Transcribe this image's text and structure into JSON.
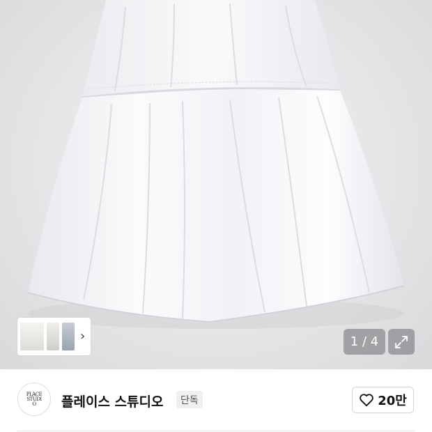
{
  "gallery": {
    "counter": "1 / 4",
    "thumbnails": [
      "thumbnail-1",
      "thumbnail-2",
      "thumbnail-3"
    ],
    "next_icon": "chevron-right-icon",
    "expand_icon": "expand-icon"
  },
  "shop": {
    "logo_text": "PLACE STUDIO",
    "name": "플레이스 스튜디오",
    "badge": "단독"
  },
  "like": {
    "icon": "heart-outline-icon",
    "count": "20만"
  }
}
